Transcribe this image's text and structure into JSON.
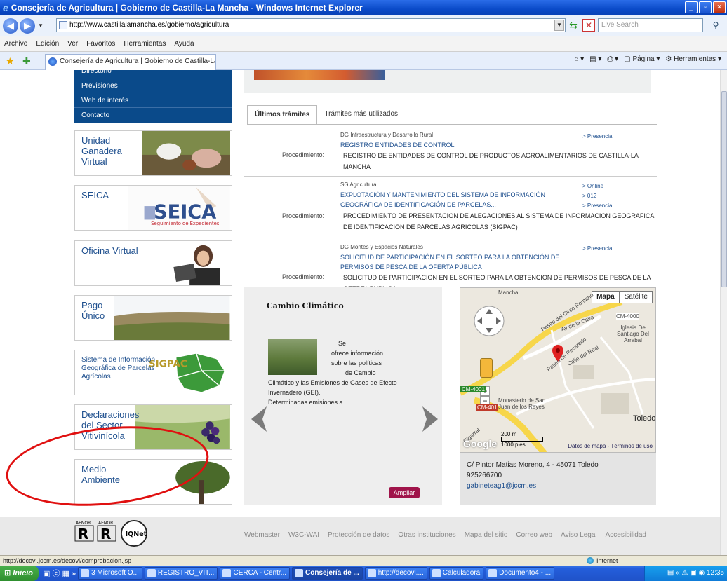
{
  "window": {
    "title": "Consejería de Agricultura | Gobierno de Castilla-La Mancha - Windows Internet Explorer",
    "minimize": "_",
    "maximize": "▫",
    "close": "×"
  },
  "addressbar": {
    "url": "http://www.castillalamancha.es/gobierno/agricultura",
    "search_placeholder": "Live Search"
  },
  "menu": [
    "Archivo",
    "Edición",
    "Ver",
    "Favoritos",
    "Herramientas",
    "Ayuda"
  ],
  "tab": {
    "label": "Consejería de Agricultura | Gobierno de Castilla-La Ma...",
    "tools_page": "Página",
    "tools_tools": "Herramientas"
  },
  "left_nav": {
    "items": [
      {
        "label": "Directorio"
      },
      {
        "label": "Previsiones"
      },
      {
        "label": "Web de interés"
      },
      {
        "label": "Contacto"
      }
    ],
    "banners": [
      {
        "title": "Unidad Ganadera Virtual"
      },
      {
        "title": "SEICA",
        "logo": "SEICA",
        "logo_sub": "Seguimiento de Expedientes"
      },
      {
        "title": "Oficina Virtual"
      },
      {
        "title": "Pago Único"
      },
      {
        "title": "Sistema de Información Geográfica de Parcelas Agrícolas",
        "logo": "SIGPAC"
      },
      {
        "title": "Declaraciones del Sector Vitivinícola"
      },
      {
        "title": "Medio Ambiente"
      }
    ]
  },
  "tramites": {
    "tabs": [
      "Últimos trámites",
      "Trámites más utilizados"
    ],
    "items": [
      {
        "dg": "DG Infraestructura y Desarrollo Rural",
        "title": "REGISTRO ENTIDADES DE CONTROL",
        "channels": [
          "> Presencial"
        ],
        "label": "Procedimiento:",
        "desc": "REGISTRO DE ENTIDADES DE CONTROL DE PRODUCTOS AGROALIMENTARIOS DE CASTILLA-LA MANCHA"
      },
      {
        "dg": "SG Agricultura",
        "title": "EXPLOTACIÓN Y MANTENIMIENTO DEL SISTEMA DE INFORMACIÓN GEOGRÁFICA DE IDENTIFICACIÓN DE PARCELAS...",
        "channels": [
          "> Online",
          "> 012",
          "> Presencial"
        ],
        "label": "Procedimiento:",
        "desc": "PROCEDIMIENTO DE PRESENTACION DE ALEGACIONES AL SISTEMA DE INFORMACION GEOGRAFICA DE IDENTIFICACION DE PARCELAS AGRICOLAS (SIGPAC)"
      },
      {
        "dg": "DG Montes y Espacios Naturales",
        "title": "SOLICITUD DE PARTICIPACIÓN EN EL SORTEO PARA LA OBTENCIÓN DE PERMISOS DE PESCA DE LA OFERTA PÚBLICA",
        "channels": [
          "> Presencial"
        ],
        "label": "Procedimiento:",
        "desc": "SOLICITUD DE PARTICIPACION EN EL SORTEO PARA LA OBTENCION DE PERMISOS DE PESCA DE LA OFERTA PUBLICA"
      }
    ]
  },
  "cambio": {
    "title": "Cambio Climático",
    "text_lines": [
      "Se",
      "ofrece información",
      "sobre las políticas",
      "de Cambio"
    ],
    "text_rest": [
      "Climático y las Emisiones de Gases de Efecto",
      "Invernadero (GEI).",
      "Determinadas emisiones a..."
    ],
    "button": "Ampliar"
  },
  "map": {
    "btn_map": "Mapa",
    "btn_sat": "Satélite",
    "labels": [
      "Mancha",
      "Paseo del Circo Romano",
      "Av de la Cava",
      "Iglesia De Santiago Del Arrabal",
      "Paseo de Recaredo",
      "Calle del Real",
      "CM-4000",
      "CM-4001",
      "CM-401",
      "Monasterio de San Juan de los Reyes",
      "Toledo",
      "Cigarral"
    ],
    "scale_m": "200 m",
    "scale_ft": "1000 pies",
    "terms": "Datos de mapa - Términos de uso",
    "google": "Google",
    "address": "C/ Pintor Matias Moreno, 4 - 45071 Toledo",
    "phone": "925266700",
    "email": "gabineteag1@jccm.es"
  },
  "footer": {
    "certs": [
      "AENOR",
      "AENOR",
      "IQNet"
    ],
    "links": [
      "Webmaster",
      "W3C-WAI",
      "Protección de datos",
      "Otras instituciones",
      "Mapa del sitio",
      "Correo web",
      "Aviso Legal",
      "Accesibilidad"
    ]
  },
  "status": {
    "url": "http://decovi.jccm.es/decovi/comprobacion.jsp",
    "zone": "Internet"
  },
  "taskbar": {
    "start": "Inicio",
    "tasks": [
      {
        "label": "3 Microsoft O...",
        "active": false
      },
      {
        "label": "REGISTRO_VIT...",
        "active": false
      },
      {
        "label": "CERCA - Centr...",
        "active": false
      },
      {
        "label": "Consejería de ...",
        "active": true
      },
      {
        "label": "http://decovi....",
        "active": false
      },
      {
        "label": "Calculadora",
        "active": false
      },
      {
        "label": "Documento4 - ...",
        "active": false
      }
    ],
    "clock": "12:35"
  },
  "colors": {
    "nav_blue": "#0a4a8a",
    "link_blue": "#1e4f8e",
    "ampliar": "#a0144a",
    "annotation": "#e01010"
  }
}
